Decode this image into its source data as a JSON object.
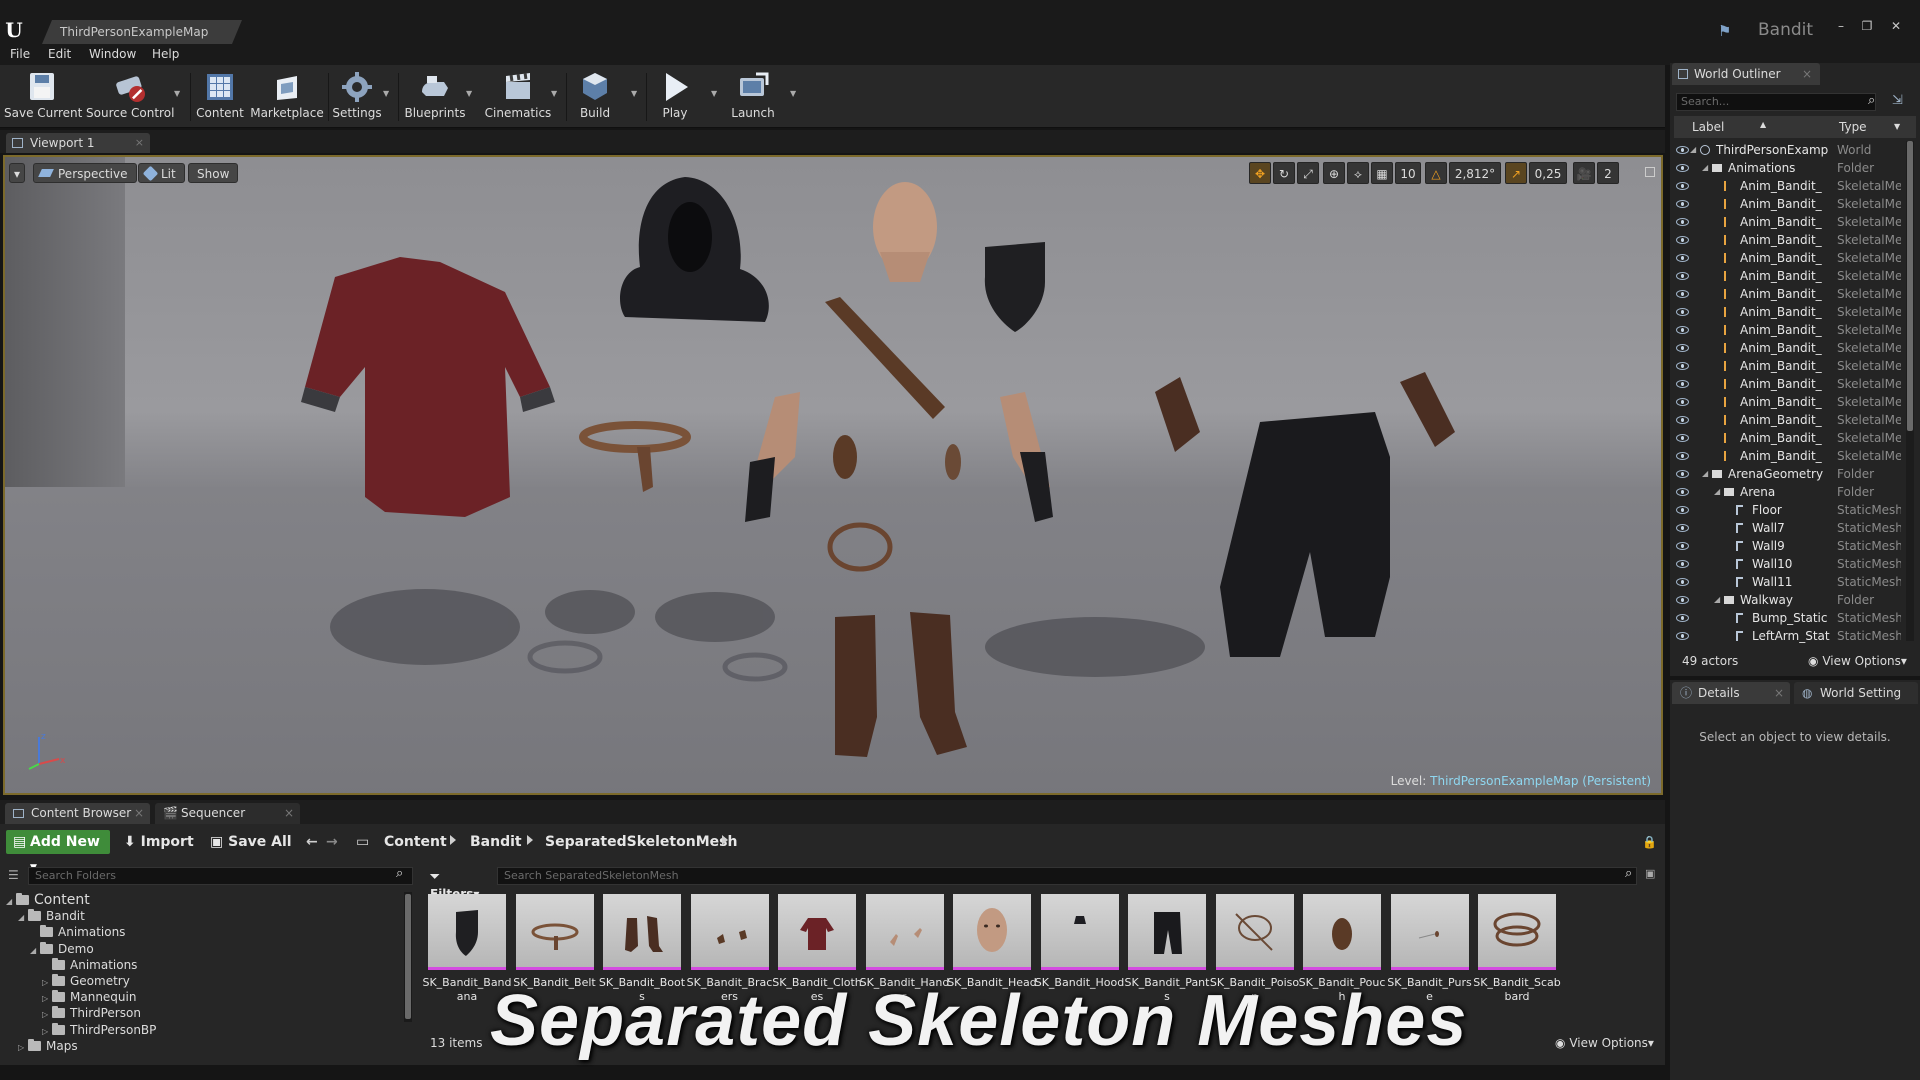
{
  "window": {
    "doc_tab": "ThirdPersonExampleMap",
    "project_name": "Bandit",
    "buttons": [
      "–",
      "❐",
      "✕"
    ]
  },
  "menu": [
    "File",
    "Edit",
    "Window",
    "Help"
  ],
  "toolbar": {
    "buttons": [
      {
        "label": "Save Current",
        "icon": "save-icon"
      },
      {
        "label": "Source Control",
        "icon": "source-control-icon"
      },
      {
        "label": "Content",
        "icon": "content-icon"
      },
      {
        "label": "Marketplace",
        "icon": "marketplace-icon"
      },
      {
        "label": "Settings",
        "icon": "settings-icon"
      },
      {
        "label": "Blueprints",
        "icon": "blueprints-icon"
      },
      {
        "label": "Cinematics",
        "icon": "cinematics-icon"
      },
      {
        "label": "Build",
        "icon": "build-icon"
      },
      {
        "label": "Play",
        "icon": "play-icon"
      },
      {
        "label": "Launch",
        "icon": "launch-icon"
      }
    ]
  },
  "viewport": {
    "tab": "Viewport 1",
    "perspective": "Perspective",
    "lit": "Lit",
    "show": "Show",
    "grid_snap": "10",
    "rotation_snap": "2,812°",
    "scale_snap": "0,25",
    "camera_speed": "2",
    "level_label": "Level:",
    "level_name": "ThirdPersonExampleMap (Persistent)"
  },
  "world_outliner": {
    "tab": "World Outliner",
    "search_placeholder": "Search...",
    "col_label": "Label",
    "col_type": "Type",
    "rows": [
      {
        "label": "ThirdPersonExamp",
        "type": "World",
        "depth": 0,
        "kind": "world"
      },
      {
        "label": "Animations",
        "type": "Folder",
        "depth": 1,
        "kind": "folder"
      },
      {
        "label": "Anim_Bandit_",
        "type": "SkeletalMe",
        "depth": 2,
        "kind": "mesh"
      },
      {
        "label": "Anim_Bandit_",
        "type": "SkeletalMe",
        "depth": 2,
        "kind": "mesh"
      },
      {
        "label": "Anim_Bandit_",
        "type": "SkeletalMe",
        "depth": 2,
        "kind": "mesh"
      },
      {
        "label": "Anim_Bandit_",
        "type": "SkeletalMe",
        "depth": 2,
        "kind": "mesh"
      },
      {
        "label": "Anim_Bandit_",
        "type": "SkeletalMe",
        "depth": 2,
        "kind": "mesh"
      },
      {
        "label": "Anim_Bandit_",
        "type": "SkeletalMe",
        "depth": 2,
        "kind": "mesh"
      },
      {
        "label": "Anim_Bandit_",
        "type": "SkeletalMe",
        "depth": 2,
        "kind": "mesh"
      },
      {
        "label": "Anim_Bandit_",
        "type": "SkeletalMe",
        "depth": 2,
        "kind": "mesh"
      },
      {
        "label": "Anim_Bandit_",
        "type": "SkeletalMe",
        "depth": 2,
        "kind": "mesh"
      },
      {
        "label": "Anim_Bandit_",
        "type": "SkeletalMe",
        "depth": 2,
        "kind": "mesh"
      },
      {
        "label": "Anim_Bandit_",
        "type": "SkeletalMe",
        "depth": 2,
        "kind": "mesh"
      },
      {
        "label": "Anim_Bandit_",
        "type": "SkeletalMe",
        "depth": 2,
        "kind": "mesh"
      },
      {
        "label": "Anim_Bandit_",
        "type": "SkeletalMe",
        "depth": 2,
        "kind": "mesh"
      },
      {
        "label": "Anim_Bandit_",
        "type": "SkeletalMe",
        "depth": 2,
        "kind": "mesh"
      },
      {
        "label": "Anim_Bandit_",
        "type": "SkeletalMe",
        "depth": 2,
        "kind": "mesh"
      },
      {
        "label": "Anim_Bandit_",
        "type": "SkeletalMe",
        "depth": 2,
        "kind": "mesh"
      },
      {
        "label": "ArenaGeometry",
        "type": "Folder",
        "depth": 1,
        "kind": "folder"
      },
      {
        "label": "Arena",
        "type": "Folder",
        "depth": 2,
        "kind": "folder"
      },
      {
        "label": "Floor",
        "type": "StaticMesh",
        "depth": 3,
        "kind": "static"
      },
      {
        "label": "Wall7",
        "type": "StaticMesh",
        "depth": 3,
        "kind": "static"
      },
      {
        "label": "Wall9",
        "type": "StaticMesh",
        "depth": 3,
        "kind": "static"
      },
      {
        "label": "Wall10",
        "type": "StaticMesh",
        "depth": 3,
        "kind": "static"
      },
      {
        "label": "Wall11",
        "type": "StaticMesh",
        "depth": 3,
        "kind": "static"
      },
      {
        "label": "Walkway",
        "type": "Folder",
        "depth": 2,
        "kind": "folder"
      },
      {
        "label": "Bump_Static",
        "type": "StaticMesh",
        "depth": 3,
        "kind": "static"
      },
      {
        "label": "LeftArm_Stat",
        "type": "StaticMesh",
        "depth": 3,
        "kind": "static"
      }
    ],
    "actor_count": "49 actors",
    "view_options": "View Options"
  },
  "details": {
    "tab": "Details",
    "tab2": "World Setting",
    "message": "Select an object to view details."
  },
  "bottom_tabs": {
    "content_browser": "Content Browser",
    "sequencer": "Sequencer"
  },
  "content_browser": {
    "add_new": "Add New",
    "import": "Import",
    "save_all": "Save All",
    "breadcrumbs": [
      "Content",
      "Bandit",
      "SeparatedSkeletonMesh"
    ],
    "folder_search": "Search Folders",
    "filters": "Filters",
    "asset_search": "Search SeparatedSkeletonMesh",
    "tree": [
      {
        "label": "Content",
        "depth": 0,
        "open": true
      },
      {
        "label": "Bandit",
        "depth": 1,
        "open": true
      },
      {
        "label": "Animations",
        "depth": 2,
        "open": null
      },
      {
        "label": "Demo",
        "depth": 2,
        "open": true
      },
      {
        "label": "Animations",
        "depth": 3,
        "open": null
      },
      {
        "label": "Geometry",
        "depth": 3,
        "open": false
      },
      {
        "label": "Mannequin",
        "depth": 3,
        "open": false
      },
      {
        "label": "ThirdPerson",
        "depth": 3,
        "open": false
      },
      {
        "label": "ThirdPersonBP",
        "depth": 3,
        "open": false
      },
      {
        "label": "Maps",
        "depth": 1,
        "open": false
      }
    ],
    "assets": [
      {
        "name": "SK_Bandit_Bandana",
        "icon": "bandana-icon"
      },
      {
        "name": "SK_Bandit_Belt",
        "icon": "belt-icon"
      },
      {
        "name": "SK_Bandit_Boots",
        "icon": "boots-icon"
      },
      {
        "name": "SK_Bandit_Bracers",
        "icon": "bracers-icon"
      },
      {
        "name": "SK_Bandit_Clothes",
        "icon": "clothes-icon"
      },
      {
        "name": "SK_Bandit_Hands",
        "icon": "hands-icon"
      },
      {
        "name": "SK_Bandit_Head",
        "icon": "head-icon"
      },
      {
        "name": "SK_Bandit_Hood",
        "icon": "hood-icon"
      },
      {
        "name": "SK_Bandit_Pants",
        "icon": "pants-icon"
      },
      {
        "name": "SK_Bandit_Poison",
        "icon": "poison-icon"
      },
      {
        "name": "SK_Bandit_Pouch",
        "icon": "pouch-icon"
      },
      {
        "name": "SK_Bandit_Purse",
        "icon": "purse-icon"
      },
      {
        "name": "SK_Bandit_Scabbard",
        "icon": "scabbard-icon"
      }
    ],
    "item_count": "13 items",
    "view_options": "View Options"
  },
  "caption": "Separated Skeleton Meshes",
  "colors": {
    "accent_green": "#3f8c3a",
    "asset_underline": "#d44be0",
    "viewport_border": "#7c6a2b",
    "level_name": "#8fd7f0"
  }
}
